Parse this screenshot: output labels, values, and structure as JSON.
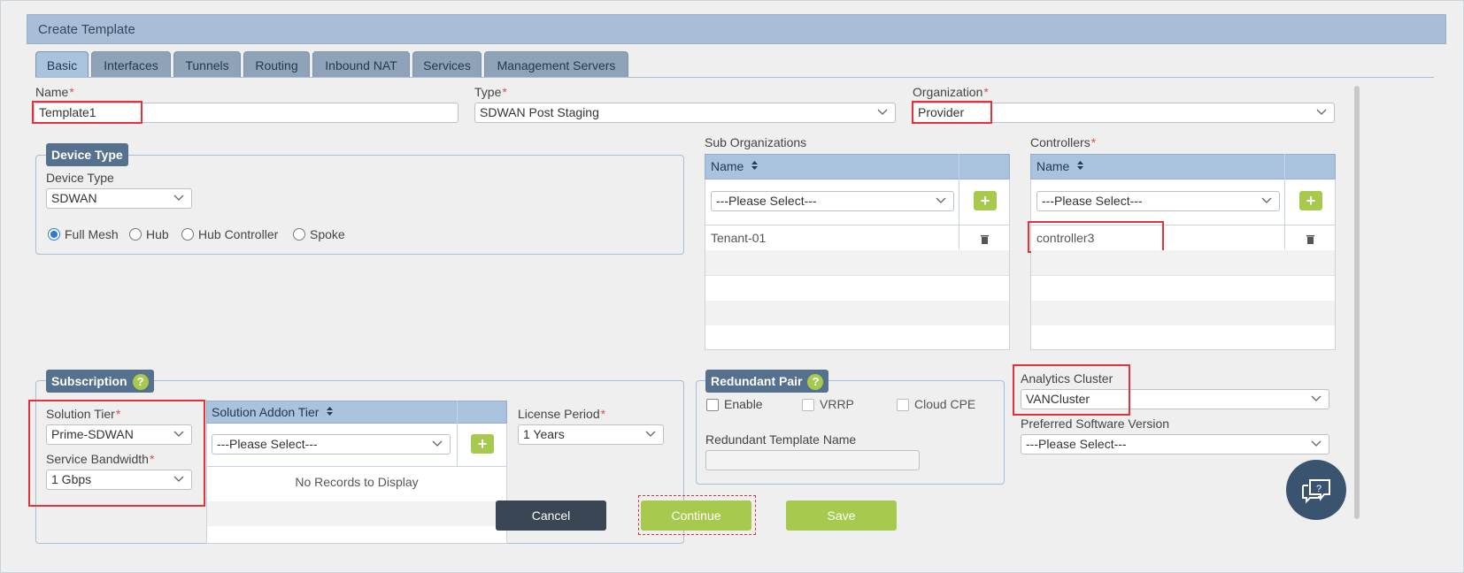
{
  "window": {
    "title": "Create Template"
  },
  "tabs": [
    {
      "label": "Basic"
    },
    {
      "label": "Interfaces"
    },
    {
      "label": "Tunnels"
    },
    {
      "label": "Routing"
    },
    {
      "label": "Inbound NAT"
    },
    {
      "label": "Services"
    },
    {
      "label": "Management Servers"
    }
  ],
  "fields": {
    "name_label": "Name",
    "name_value": "Template1",
    "type_label": "Type",
    "type_value": "SDWAN Post Staging",
    "org_label": "Organization",
    "org_value": "Provider",
    "required_mark": "*"
  },
  "device_type": {
    "legend": "Device Type",
    "field_label": "Device Type",
    "value": "SDWAN",
    "options": [
      "Full Mesh",
      "Hub",
      "Hub Controller",
      "Spoke"
    ],
    "selected": "Full Mesh"
  },
  "sub_orgs": {
    "label": "Sub Organizations",
    "col_name": "Name",
    "placeholder": "---Please Select---",
    "rows": [
      "Tenant-01"
    ]
  },
  "controllers": {
    "label": "Controllers",
    "col_name": "Name",
    "placeholder": "---Please Select---",
    "rows": [
      "controller3"
    ]
  },
  "subscription": {
    "legend": "Subscription",
    "solution_tier_label": "Solution Tier",
    "solution_tier_value": "Prime-SDWAN",
    "bandwidth_label": "Service Bandwidth",
    "bandwidth_value": "1 Gbps",
    "addon_header": "Solution Addon Tier",
    "addon_placeholder": "---Please Select---",
    "addon_empty": "No Records to Display",
    "license_label": "License Period",
    "license_value": "1 Years"
  },
  "redundant": {
    "legend": "Redundant Pair",
    "enable": "Enable",
    "vrrp": "VRRP",
    "cloud_cpe": "Cloud CPE",
    "template_label": "Redundant Template Name"
  },
  "analytics": {
    "label": "Analytics Cluster",
    "value": "VANCluster",
    "software_label": "Preferred Software Version",
    "software_value": "---Please Select---"
  },
  "help_mark": "?",
  "buttons": {
    "cancel": "Cancel",
    "continue": "Continue",
    "save": "Save"
  },
  "colors": {
    "accent": "#a6c94e",
    "header": "#a9bed6",
    "cancel": "#3b4655",
    "highlight": "#e53238"
  }
}
